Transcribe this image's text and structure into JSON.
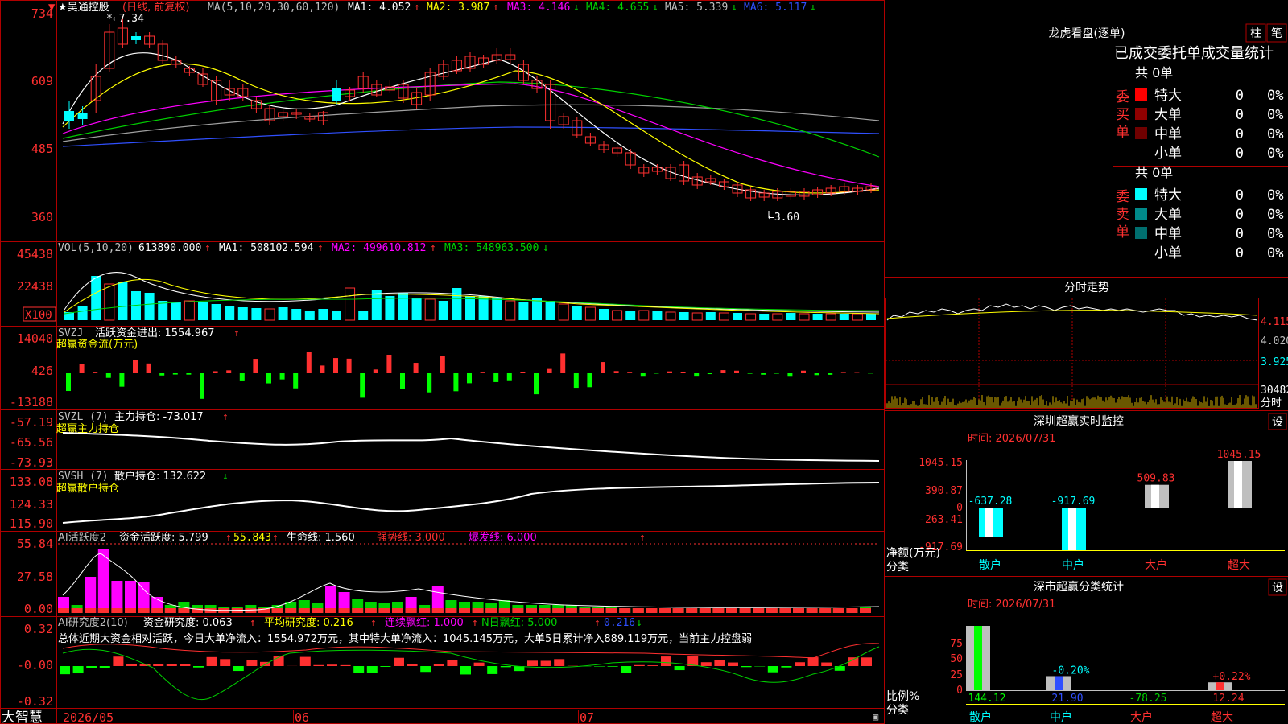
{
  "colors": {
    "up": "#ff3030",
    "down": "#00ffff",
    "grid": "#b00000",
    "text": "#c0c0c0",
    "white": "#ffffff",
    "yellow": "#ffff00",
    "magenta": "#ff00ff",
    "green": "#00d000",
    "blue": "#3050ff",
    "grey": "#a0a0a0"
  },
  "header": {
    "stock_name": "★吴通控股",
    "period": "(日线, 前复权)",
    "ma_title": "MA(5,10,20,30,60,120)",
    "ma_values": [
      "MA1: 4.052",
      "MA2: 3.987",
      "MA3: 4.146",
      "MA4: 4.655",
      "MA5: 5.339",
      "MA6: 5.117"
    ],
    "ma_arrows": [
      "↑",
      "↑",
      "↓",
      "↓",
      "↓",
      "↓"
    ],
    "high_mark": "7.34",
    "low_mark": "←3.60",
    "red_flag": "↑"
  },
  "price_axis": [
    "734",
    "609",
    "485",
    "360"
  ],
  "vol": {
    "title": "VOL(5,10,20)",
    "value": "613890.000",
    "ma1": "MA1: 508102.594",
    "ma2": "MA2: 499610.812",
    "ma3": "MA3: 548963.500",
    "arrows": [
      "↑",
      "↑",
      "↑",
      "↓"
    ],
    "axis": [
      "45438",
      "22438"
    ],
    "unit": "X100"
  },
  "svzj": {
    "title": "SVZJ",
    "label": "活跃资金进出: 1554.967",
    "arrow": "↑",
    "sub": "超赢资金流(万元)",
    "axis": [
      "14040",
      "426",
      "-13188"
    ]
  },
  "svzl": {
    "title": "SVZL (7)",
    "label": "主力持仓: -73.017",
    "arrow": "↑",
    "sub": "超赢主力持仓",
    "axis": [
      "-57.19",
      "-65.56",
      "-73.93"
    ]
  },
  "svsh": {
    "title": "SVSH (7)",
    "label": "散户持仓: 132.622",
    "arrow": "↓",
    "sub": "超赢散户持仓",
    "axis": [
      "133.08",
      "124.33",
      "115.90"
    ]
  },
  "ai1": {
    "title": "AI活跃度2",
    "label1": "资金活跃度: 5.799",
    "value2": "55.843",
    "label3": "生命线: 1.560",
    "label4": "强势线: 3.000",
    "label5": "爆发线: 6.000",
    "axis": [
      "55.84",
      "27.58",
      "0.00"
    ]
  },
  "ai2": {
    "title": "AI研究度2(10)",
    "label1": "资金研究度: 0.063",
    "label2": "平均研究度: 0.216",
    "label3": "连续飘红: 1.000",
    "label4": "N日飘红: 5.000",
    "label5": "0.216",
    "summary": "总体近期大资金相对活跃，今日大单净流入：1554.972万元，其中特大单净流入：1045.145万元，大单5日累计净入889.119万元，当前主力控盘弱",
    "axis": [
      "0.32",
      "-0.00",
      "-0.32"
    ]
  },
  "date_axis": [
    "2026/05",
    "06",
    "07"
  ],
  "brand": "大智慧",
  "right": {
    "lhb_title": "龙虎看盘(逐单)",
    "tabs": [
      "柱",
      "笔"
    ],
    "headline": "已成交委托单成交量统计",
    "buy": {
      "label": "委买单",
      "total": "共 0单",
      "rows": [
        {
          "name": "特大",
          "count": "0",
          "pct": "0%"
        },
        {
          "name": "大单",
          "count": "0",
          "pct": "0%"
        },
        {
          "name": "中单",
          "count": "0",
          "pct": "0%"
        },
        {
          "name": "小单",
          "count": "0",
          "pct": "0%"
        }
      ]
    },
    "sell": {
      "label": "委卖单",
      "total": "共 0单",
      "rows": [
        {
          "name": "特大",
          "count": "0",
          "pct": "0%"
        },
        {
          "name": "大单",
          "count": "0",
          "pct": "0%"
        },
        {
          "name": "中单",
          "count": "0",
          "pct": "0%"
        },
        {
          "name": "小单",
          "count": "0",
          "pct": "0%"
        }
      ]
    },
    "fenshi": {
      "title": "分时走势",
      "axis": [
        "4.115",
        "4.020",
        "3.925",
        "30482",
        "分时"
      ]
    },
    "monitor": {
      "title": "深圳超赢实时监控",
      "setting": "设",
      "time": "时间: 2026/07/31",
      "axis": [
        "1045.15",
        "390.87",
        "0",
        "-263.41",
        "-917.69"
      ],
      "ylabel": "净额(万元)",
      "xlabel": "分类"
    },
    "classify": {
      "title": "深市超赢分类统计",
      "setting": "设",
      "time": "时间: 2026/07/31",
      "axis": [
        "75",
        "50",
        "25",
        "0"
      ],
      "ylabel": "比例%",
      "xlabel": "分类"
    }
  },
  "chart_data": [
    {
      "type": "bar",
      "title": "深圳超赢实时监控",
      "categories": [
        "散户",
        "中户",
        "大户",
        "超大"
      ],
      "values": [
        -637.28,
        -917.69,
        509.83,
        1045.15
      ],
      "ylabel": "净额(万元)",
      "xlabel": "分类",
      "ylim": [
        -917.69,
        1045.15
      ]
    },
    {
      "type": "bar",
      "title": "深市超赢分类统计",
      "categories": [
        "散户",
        "中户",
        "大户",
        "超大"
      ],
      "values": [
        144.12,
        21.9,
        -78.25,
        12.24
      ],
      "labels": [
        "",
        "-0.20%",
        "",
        "+0.22%"
      ],
      "ylabel": "比例%",
      "xlabel": "分类",
      "ylim": [
        0,
        75
      ]
    },
    {
      "type": "line",
      "title": "吴通控股 日线 (前复权)",
      "ylim": [
        3.6,
        7.34
      ],
      "annotations": [
        "7.34",
        "←3.60"
      ]
    }
  ]
}
